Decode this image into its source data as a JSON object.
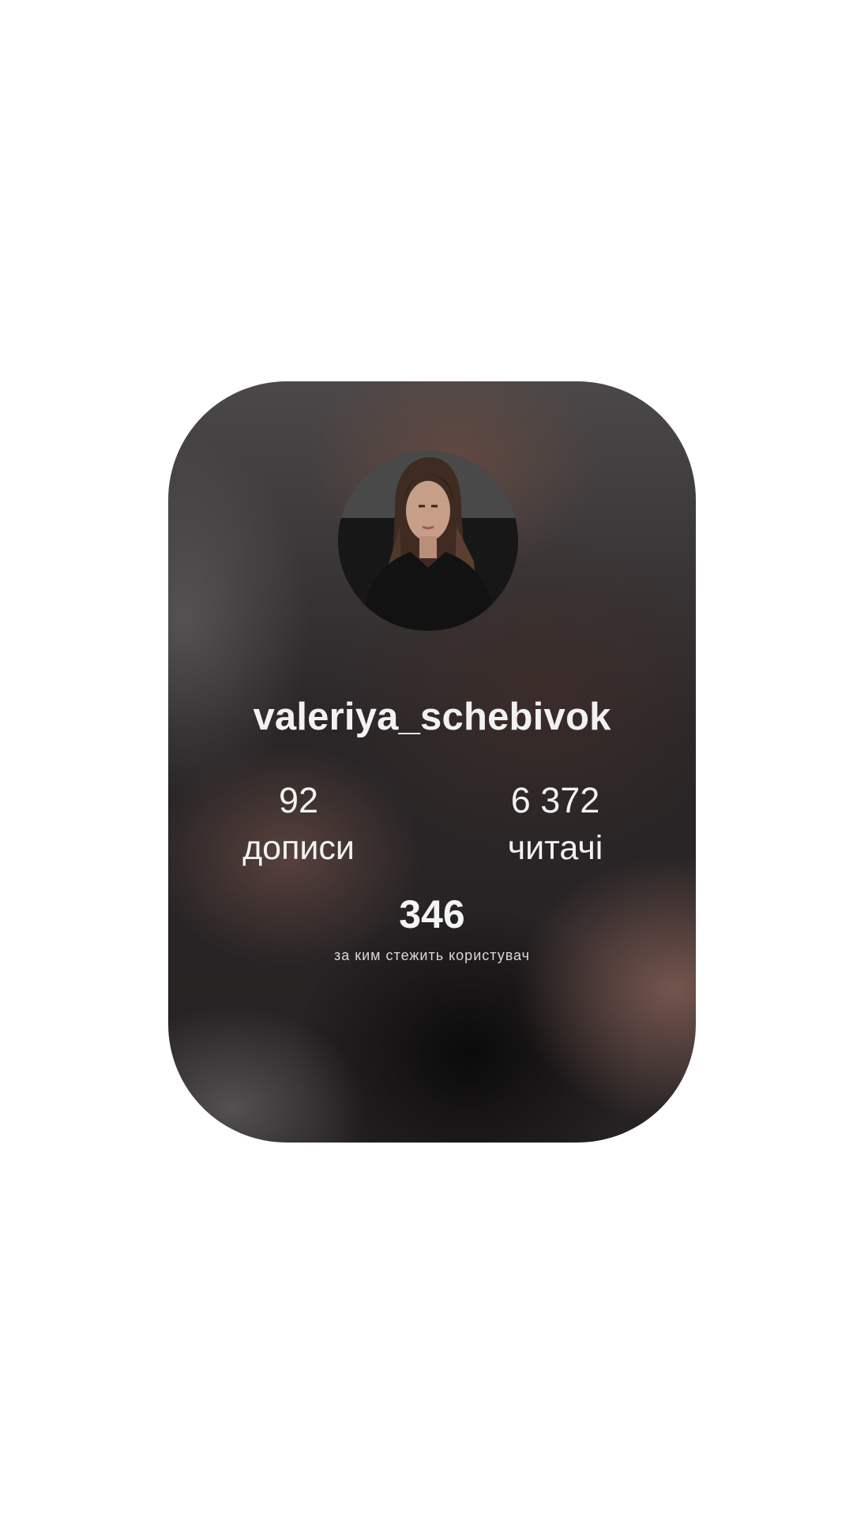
{
  "profile": {
    "username": "valeriya_schebivok",
    "stats": {
      "posts_value": "92",
      "posts_label": "дописи",
      "followers_value": "6 372",
      "followers_label": "читачі",
      "following_value": "346",
      "following_label": "за ким стежить користувач"
    }
  },
  "colors": {
    "page_background": "#ffffff",
    "card_dark": "#2a2627",
    "text": "#f2f2f2"
  },
  "icons": {
    "avatar": "profile-photo"
  }
}
